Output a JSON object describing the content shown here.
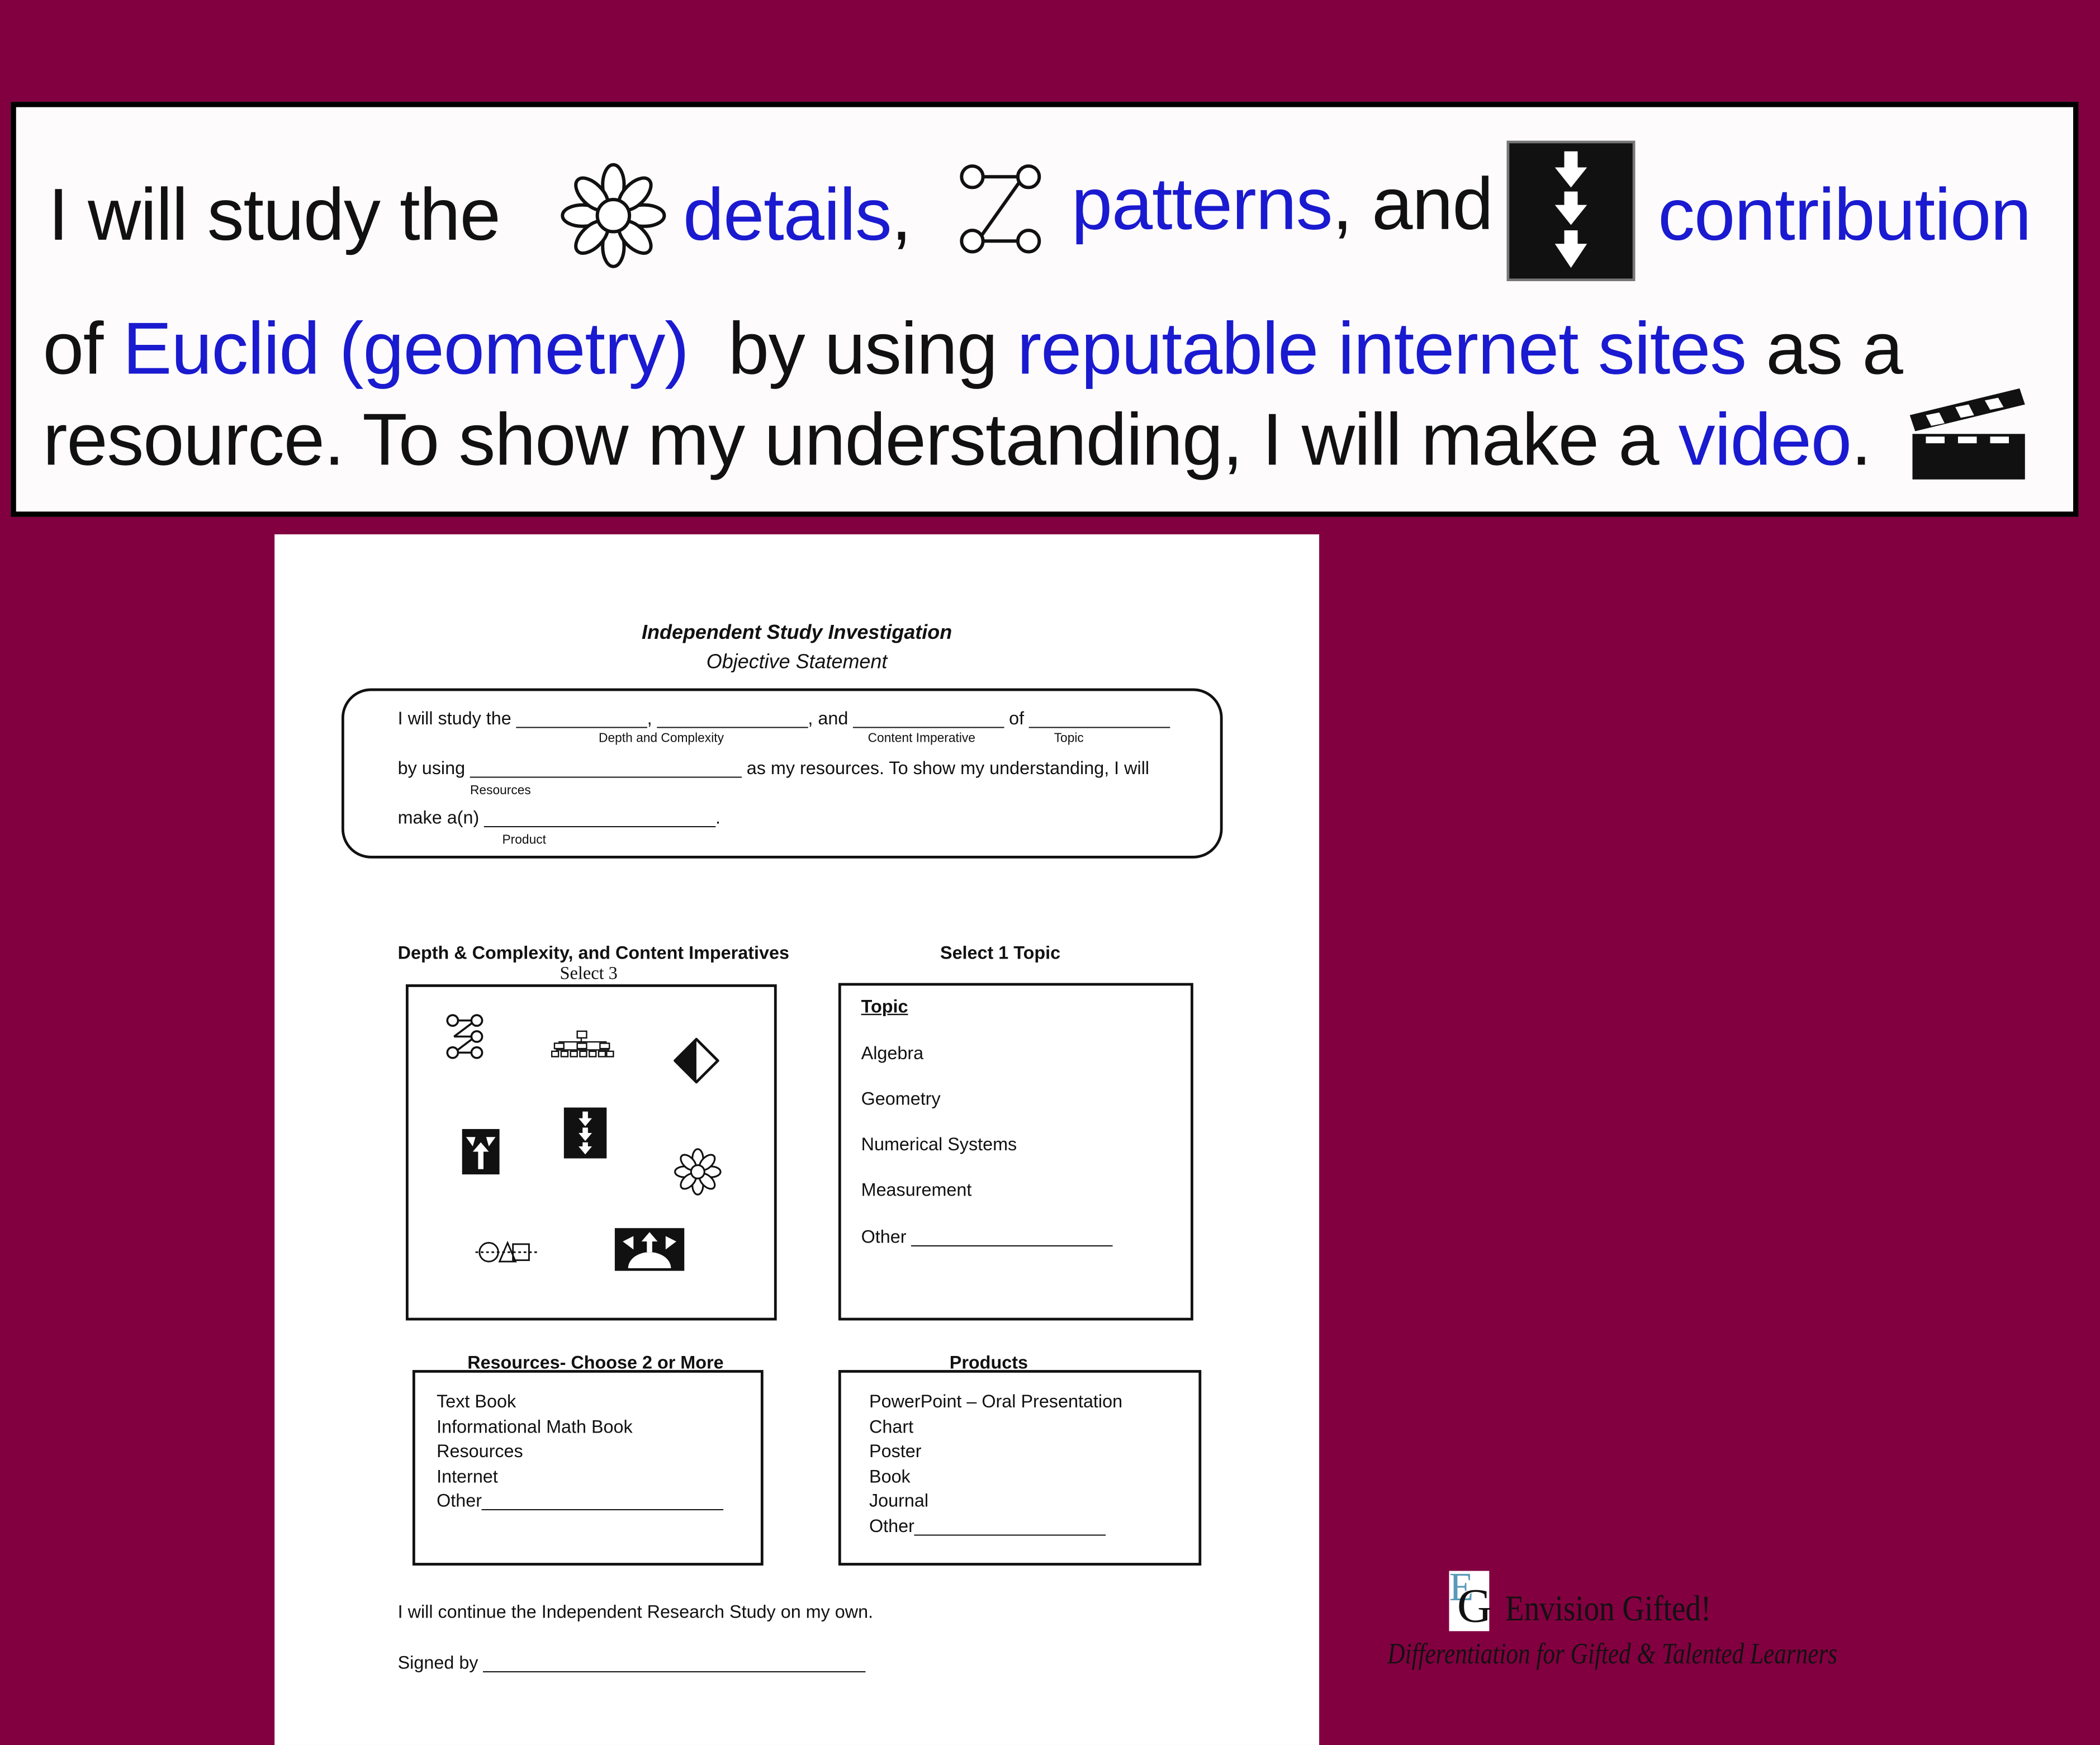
{
  "colors": {
    "background": "#820040",
    "accent_blue": "#1a1ad0"
  },
  "banner": {
    "line1": {
      "prefix": "I will study the",
      "word1": "details",
      "sep1": ",",
      "word2": "patterns",
      "sep2": ", and",
      "word3": "contribution"
    },
    "line2": {
      "prefix": "of ",
      "topic": "Euclid (geometry)",
      "mid": "  by using ",
      "resource": "reputable internet sites",
      "suffix": " as a"
    },
    "line3": {
      "prefix": "resource.  To show my understanding, I will make a ",
      "product": "video",
      "suffix": "."
    },
    "icons": [
      "flower-details-icon",
      "patterns-icon",
      "contribution-arrows-icon",
      "clapperboard-icon"
    ]
  },
  "document": {
    "title": "Independent Study Investigation",
    "subtitle": "Objective Statement",
    "objective": {
      "line1": "I will study the _____________, _______________, and _______________ of ______________",
      "label_dc": "Depth and Complexity",
      "label_ci": "Content Imperative",
      "label_topic": "Topic",
      "line2": "by using ___________________________ as my resources.  To show my understanding, I will",
      "label_resources": "Resources",
      "line3": "make a(n) _______________________.",
      "label_product": "Product"
    },
    "dc_section": {
      "heading": "Depth & Complexity, and Content Imperatives",
      "subheading": "Select 3",
      "icons": [
        "patterns-icon",
        "big-idea-hierarchy-icon",
        "ethics-icon",
        "trends-icon",
        "contribution-icon",
        "details-icon",
        "change-over-time-icon",
        "multiple-perspectives-icon"
      ]
    },
    "topic_section": {
      "heading": "Select 1 Topic",
      "list_heading": "Topic",
      "items": [
        "Algebra",
        "Geometry",
        "Numerical Systems",
        "Measurement",
        "Other ____________________"
      ]
    },
    "resources_section": {
      "heading": "Resources- Choose 2 or More",
      "items": [
        "Text Book",
        "Informational Math Book",
        "Resources",
        "Internet",
        "Other________________________"
      ]
    },
    "products_section": {
      "heading": "Products",
      "items": [
        "PowerPoint – Oral Presentation",
        "Chart",
        "Poster",
        "Book",
        "Journal",
        "Other___________________"
      ]
    },
    "footer": {
      "continue": "I will continue the Independent Research Study on my own.",
      "signed": "Signed by ______________________________________"
    }
  },
  "logo": {
    "mark": "EG",
    "name": "Envision Gifted!",
    "tagline": "Differentiation for Gifted & Talented Learners"
  }
}
